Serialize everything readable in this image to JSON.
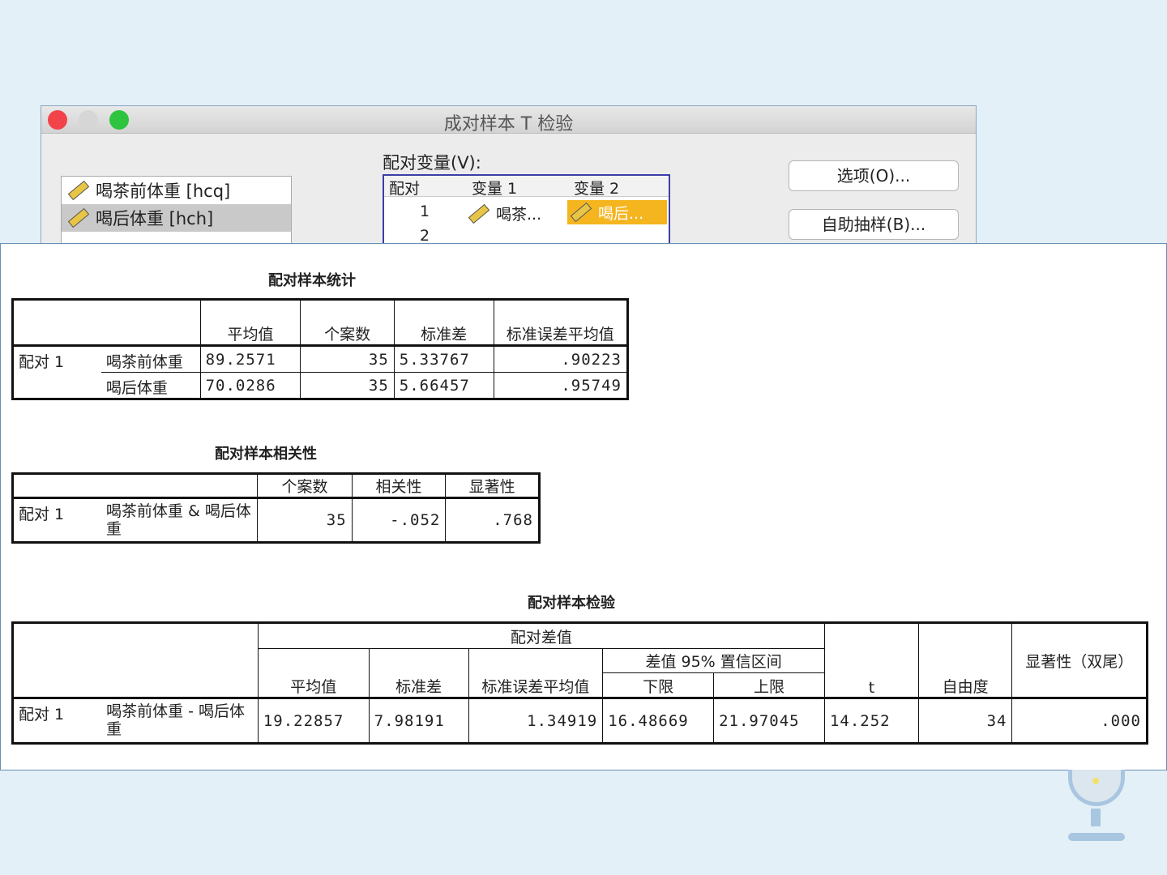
{
  "dialog": {
    "title": "成对样本 T 检验",
    "variables": [
      "喝茶前体重 [hcq]",
      "喝后体重 [hch]"
    ],
    "paired_label": "配对变量(V):",
    "grid": {
      "headers": [
        "配对",
        "变量 1",
        "变量 2"
      ],
      "rows": [
        [
          "1",
          "喝茶...",
          "喝后..."
        ],
        [
          "2",
          "",
          ""
        ]
      ]
    },
    "buttons": {
      "options": "选项(O)...",
      "bootstrap": "自助抽样(B)..."
    }
  },
  "stats": {
    "title": "配对样本统计",
    "headers": [
      "平均值",
      "个案数",
      "标准差",
      "标准误差平均值"
    ],
    "pair": "配对 1",
    "rows": [
      {
        "var": "喝茶前体重",
        "mean": "89.2571",
        "n": "35",
        "sd": "5.33767",
        "se": ".90223"
      },
      {
        "var": "喝后体重",
        "mean": "70.0286",
        "n": "35",
        "sd": "5.66457",
        "se": ".95749"
      }
    ]
  },
  "corr": {
    "title": "配对样本相关性",
    "headers": [
      "个案数",
      "相关性",
      "显著性"
    ],
    "pair": "配对 1",
    "var": "喝茶前体重 & 喝后体重",
    "n": "35",
    "r": "-.052",
    "sig": ".768"
  },
  "test": {
    "title": "配对样本检验",
    "group": "配对差值",
    "ci": "差值 95% 置信区间",
    "headers": [
      "平均值",
      "标准差",
      "标准误差平均值",
      "下限",
      "上限",
      "t",
      "自由度",
      "显著性（双尾）"
    ],
    "pair": "配对 1",
    "var": "喝茶前体重 - 喝后体重",
    "values": [
      "19.22857",
      "7.98191",
      "1.34919",
      "16.48669",
      "21.97045",
      "14.252",
      "34",
      ".000"
    ]
  }
}
